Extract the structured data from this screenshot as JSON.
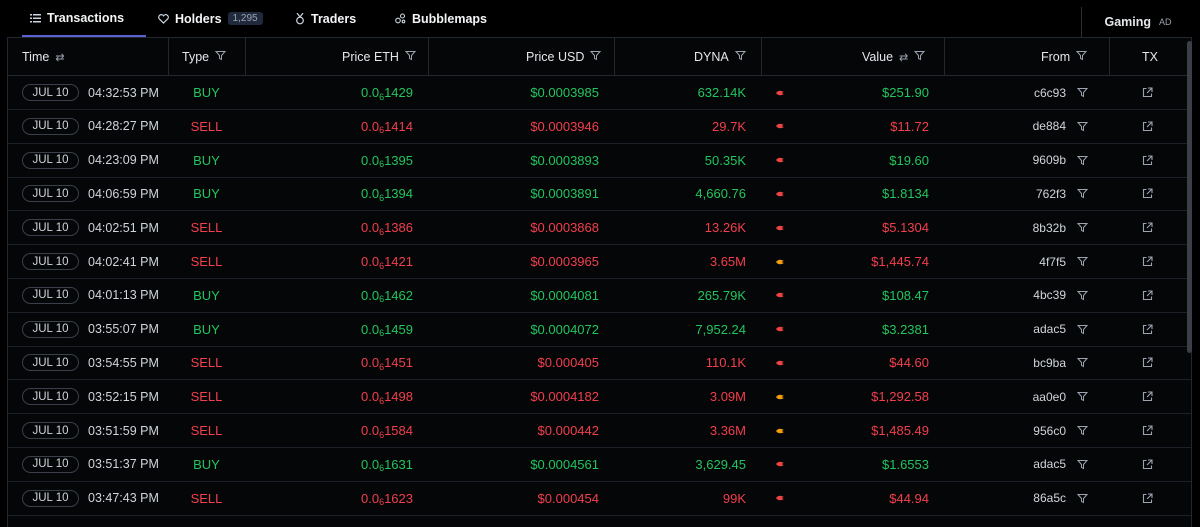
{
  "tabs": {
    "transactions": "Transactions",
    "holders": "Holders",
    "holders_count": "1,295",
    "traders": "Traders",
    "bubblemaps": "Bubblemaps"
  },
  "ad": {
    "label": "Gaming",
    "tag": "AD"
  },
  "columns": {
    "time": "Time",
    "type": "Type",
    "price_eth": "Price ETH",
    "price_usd": "Price USD",
    "token": "DYNA",
    "value": "Value",
    "from": "From",
    "tx": "TX"
  },
  "colors": {
    "buy": "#22c55e",
    "sell": "#f23f4c",
    "accent": "#5b63d3"
  },
  "rows": [
    {
      "date": "JUL 10",
      "time": "04:32:53 PM",
      "type": "BUY",
      "eth_prefix": "0.0",
      "eth_sub": "6",
      "eth_digits": "1429",
      "usd": "$0.0003985",
      "amount": "632.14K",
      "value": "$251.90",
      "from": "c6c93"
    },
    {
      "date": "JUL 10",
      "time": "04:28:27 PM",
      "type": "SELL",
      "eth_prefix": "0.0",
      "eth_sub": "6",
      "eth_digits": "1414",
      "usd": "$0.0003946",
      "amount": "29.7K",
      "value": "$11.72",
      "from": "de884"
    },
    {
      "date": "JUL 10",
      "time": "04:23:09 PM",
      "type": "BUY",
      "eth_prefix": "0.0",
      "eth_sub": "6",
      "eth_digits": "1395",
      "usd": "$0.0003893",
      "amount": "50.35K",
      "value": "$19.60",
      "from": "9609b"
    },
    {
      "date": "JUL 10",
      "time": "04:06:59 PM",
      "type": "BUY",
      "eth_prefix": "0.0",
      "eth_sub": "6",
      "eth_digits": "1394",
      "usd": "$0.0003891",
      "amount": "4,660.76",
      "value": "$1.8134",
      "from": "762f3"
    },
    {
      "date": "JUL 10",
      "time": "04:02:51 PM",
      "type": "SELL",
      "eth_prefix": "0.0",
      "eth_sub": "6",
      "eth_digits": "1386",
      "usd": "$0.0003868",
      "amount": "13.26K",
      "value": "$5.1304",
      "from": "8b32b"
    },
    {
      "date": "JUL 10",
      "time": "04:02:41 PM",
      "type": "SELL",
      "eth_prefix": "0.0",
      "eth_sub": "6",
      "eth_digits": "1421",
      "usd": "$0.0003965",
      "amount": "3.65M",
      "value": "$1,445.74",
      "from": "4f7f5"
    },
    {
      "date": "JUL 10",
      "time": "04:01:13 PM",
      "type": "BUY",
      "eth_prefix": "0.0",
      "eth_sub": "6",
      "eth_digits": "1462",
      "usd": "$0.0004081",
      "amount": "265.79K",
      "value": "$108.47",
      "from": "4bc39"
    },
    {
      "date": "JUL 10",
      "time": "03:55:07 PM",
      "type": "BUY",
      "eth_prefix": "0.0",
      "eth_sub": "6",
      "eth_digits": "1459",
      "usd": "$0.0004072",
      "amount": "7,952.24",
      "value": "$3.2381",
      "from": "adac5"
    },
    {
      "date": "JUL 10",
      "time": "03:54:55 PM",
      "type": "SELL",
      "eth_prefix": "0.0",
      "eth_sub": "6",
      "eth_digits": "1451",
      "usd": "$0.000405",
      "amount": "110.1K",
      "value": "$44.60",
      "from": "bc9ba"
    },
    {
      "date": "JUL 10",
      "time": "03:52:15 PM",
      "type": "SELL",
      "eth_prefix": "0.0",
      "eth_sub": "6",
      "eth_digits": "1498",
      "usd": "$0.0004182",
      "amount": "3.09M",
      "value": "$1,292.58",
      "from": "aa0e0"
    },
    {
      "date": "JUL 10",
      "time": "03:51:59 PM",
      "type": "SELL",
      "eth_prefix": "0.0",
      "eth_sub": "6",
      "eth_digits": "1584",
      "usd": "$0.000442",
      "amount": "3.36M",
      "value": "$1,485.49",
      "from": "956c0"
    },
    {
      "date": "JUL 10",
      "time": "03:51:37 PM",
      "type": "BUY",
      "eth_prefix": "0.0",
      "eth_sub": "6",
      "eth_digits": "1631",
      "usd": "$0.0004561",
      "amount": "3,629.45",
      "value": "$1.6553",
      "from": "adac5"
    },
    {
      "date": "JUL 10",
      "time": "03:47:43 PM",
      "type": "SELL",
      "eth_prefix": "0.0",
      "eth_sub": "6",
      "eth_digits": "1623",
      "usd": "$0.000454",
      "amount": "99K",
      "value": "$44.94",
      "from": "86a5c"
    }
  ]
}
